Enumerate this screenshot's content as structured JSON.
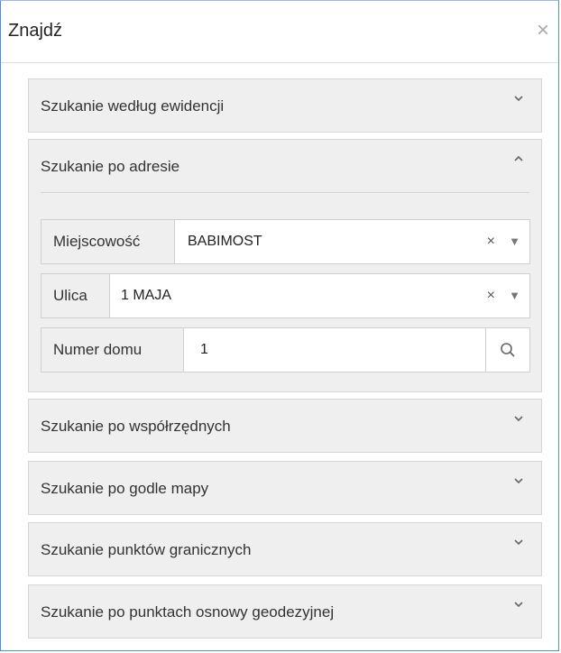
{
  "dialog": {
    "title": "Znajdź",
    "close_symbol": "×"
  },
  "sections": [
    {
      "label": "Szukanie według ewidencji",
      "expanded": false
    },
    {
      "label": "Szukanie po adresie",
      "expanded": true
    },
    {
      "label": "Szukanie po współrzędnych",
      "expanded": false
    },
    {
      "label": "Szukanie po godle mapy",
      "expanded": false
    },
    {
      "label": "Szukanie punktów granicznych",
      "expanded": false
    },
    {
      "label": "Szukanie po punktach osnowy geodezyjnej",
      "expanded": false
    }
  ],
  "address": {
    "town": {
      "label": "Miejscowość",
      "value": "BABIMOST"
    },
    "street": {
      "label": "Ulica",
      "value": "1 MAJA"
    },
    "house": {
      "label": "Numer domu",
      "value": "1"
    },
    "clear_symbol": "×",
    "dropdown_symbol": "▼"
  },
  "colors": {
    "accent_border": "#4a90e2",
    "section_bg": "#efefef"
  }
}
